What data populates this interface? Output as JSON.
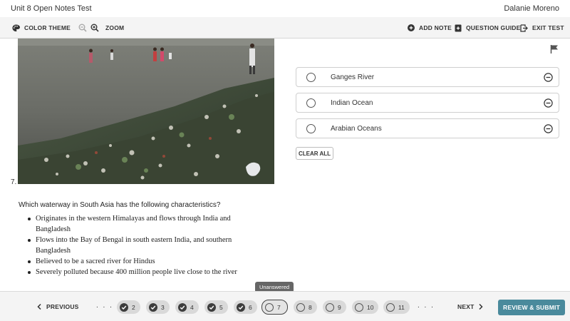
{
  "app": {
    "title": "Unit 8 Open Notes Test",
    "user_name": "Dalanie Moreno"
  },
  "toolbar": {
    "color_theme_label": "COLOR THEME",
    "zoom_label": "ZOOM",
    "add_note_label": "ADD NOTE",
    "question_guide_label": "QUESTION GUIDE",
    "exit_test_label": "EXIT TEST"
  },
  "question": {
    "number": "7.",
    "prompt": "Which waterway in South Asia has the following characteristics?",
    "bullets": [
      "Originates in the western Himalayas and flows through India and Bangladesh",
      "Flows into the Bay of Bengal in south eastern India, and southern Bangladesh",
      "Believed to be a sacred river for Hindus",
      "Severely polluted because 400 million people live close to the river"
    ],
    "image_icon": "polluted-river-photo"
  },
  "options": [
    {
      "label": "Ganges River"
    },
    {
      "label": "Indian Ocean"
    },
    {
      "label": "Arabian Oceans"
    }
  ],
  "clear_all_label": "CLEAR ALL",
  "navigation": {
    "previous_label": "PREVIOUS",
    "next_label": "NEXT",
    "ellipsis": ". . .",
    "questions": [
      {
        "num": "2",
        "answered": true
      },
      {
        "num": "3",
        "answered": true
      },
      {
        "num": "4",
        "answered": true
      },
      {
        "num": "5",
        "answered": true
      },
      {
        "num": "6",
        "answered": true
      },
      {
        "num": "7",
        "answered": false,
        "current": true
      },
      {
        "num": "8",
        "answered": false
      },
      {
        "num": "9",
        "answered": false
      },
      {
        "num": "10",
        "answered": false
      },
      {
        "num": "11",
        "answered": false
      }
    ],
    "tooltip": "Unanswered",
    "review_submit_label": "REVIEW & SUBMIT"
  },
  "colors": {
    "accent": "#4a8a9c",
    "toolbar_bg": "#f4f4f4",
    "pill_bg": "#d9d9d9"
  }
}
